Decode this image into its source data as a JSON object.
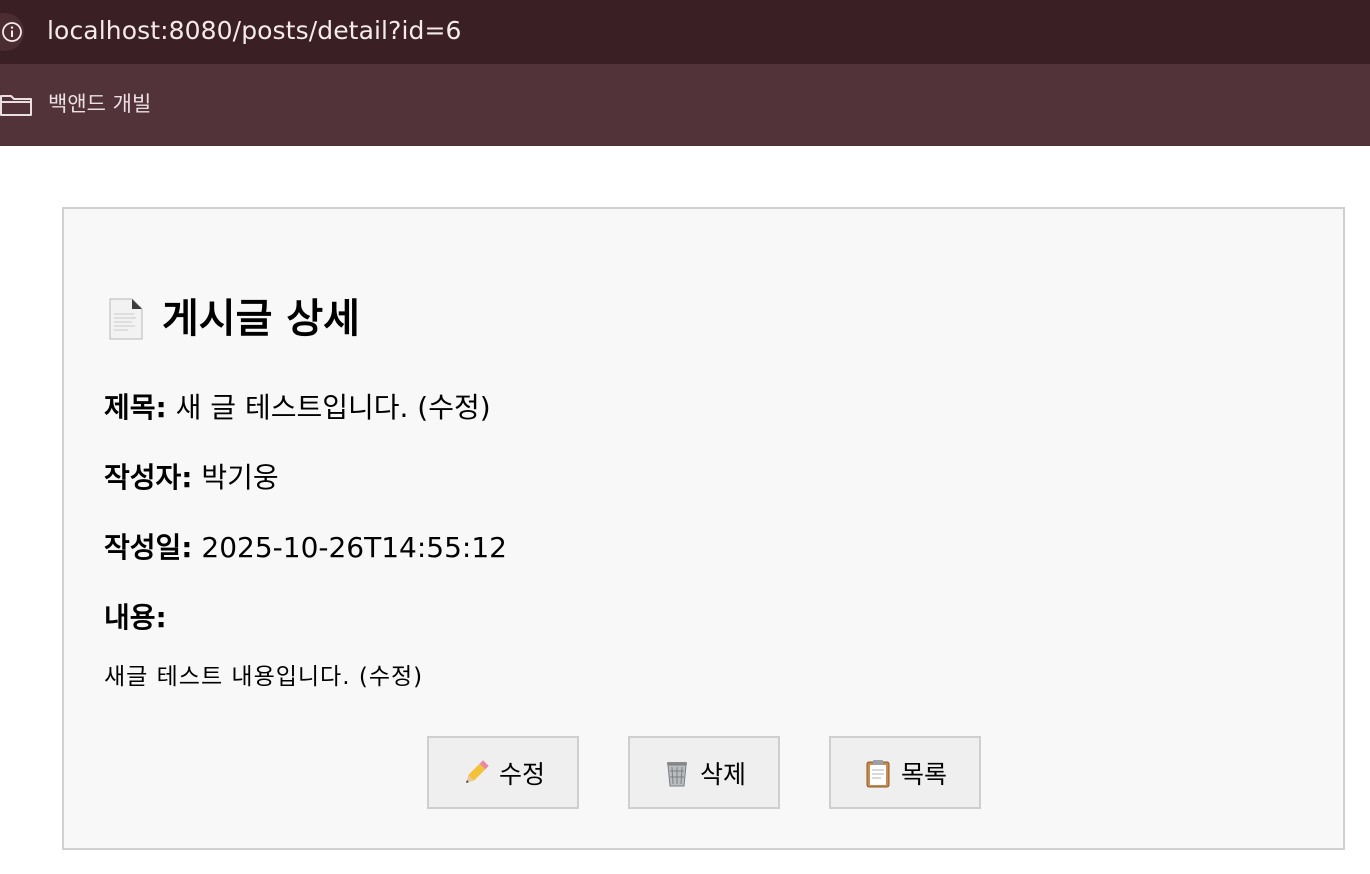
{
  "browser": {
    "url": "localhost:8080/posts/detail?id=6",
    "bookmarks": [
      {
        "label": "백앤드 개빌",
        "icon": "folder-icon"
      }
    ]
  },
  "post": {
    "heading": "게시글 상세",
    "heading_icon": "document-icon",
    "fields": {
      "title_label": "제목:",
      "title_value": "새 글 테스트입니다. (수정)",
      "author_label": "작성자:",
      "author_value": "박기웅",
      "date_label": "작성일:",
      "date_value": "2025-10-26T14:55:12",
      "content_label": "내용:"
    },
    "content": "새글 테스트 내용입니다. (수정)"
  },
  "actions": {
    "edit_label": "수정",
    "edit_icon": "pencil-icon",
    "delete_label": "삭제",
    "delete_icon": "wastebasket-icon",
    "list_label": "목록",
    "list_icon": "clipboard-icon"
  },
  "colors": {
    "address_bar_bg": "#3a1f24",
    "bookmarks_bar_bg": "#52333a",
    "card_bg": "#f8f8f8",
    "button_bg": "#efefef"
  }
}
